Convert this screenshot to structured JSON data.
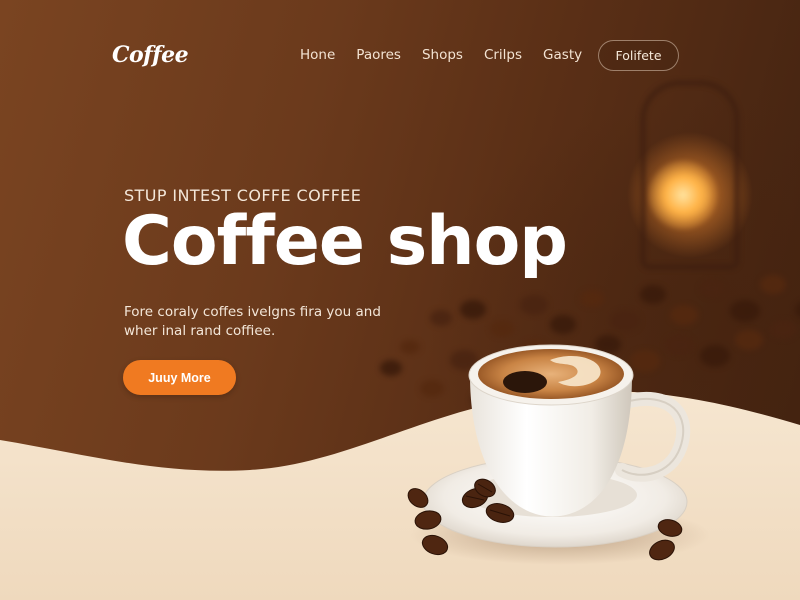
{
  "brand": {
    "logo": "Coffee"
  },
  "nav": {
    "items": [
      "Hone",
      "Paores",
      "Shops",
      "Crilps",
      "Gasty"
    ],
    "button": "Folifete"
  },
  "hero": {
    "eyebrow": "STUP INTEST COFFE COFFEE",
    "title": "Coffee shop",
    "subtitle_line1": "Fore coraly coffes ivelgns fira you and",
    "subtitle_line2": "wher inal rand coffiee.",
    "cta": "Juuy More"
  },
  "colors": {
    "accent": "#f07a21",
    "background_dark": "#6b3a1c",
    "cream": "#f3e2cc"
  },
  "icons": [
    "lamp-image",
    "coffee-cup-image",
    "coffee-beans-image"
  ]
}
